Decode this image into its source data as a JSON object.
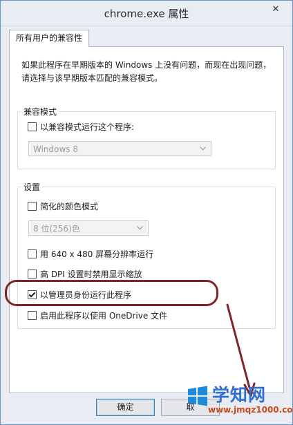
{
  "window": {
    "title": "chrome.exe 属性",
    "close_glyph": "✕"
  },
  "tabs": [
    {
      "label": "所有用户的兼容性",
      "selected": true
    }
  ],
  "description": {
    "line1": "如果此程序在早期版本的 Windows 上没有问题，而现在出现问题，",
    "line2": "请选择与该早期版本匹配的兼容模式。"
  },
  "compat_mode": {
    "legend": "兼容模式",
    "checkbox_label": "以兼容模式运行这个程序:",
    "checked": false,
    "os_select_value": "Windows 8",
    "os_select_enabled": false
  },
  "settings": {
    "legend": "设置",
    "reduced_color": {
      "label": "简化的颜色模式",
      "checked": false
    },
    "color_select_value": "8 位(256)色",
    "color_select_enabled": false,
    "res_640": {
      "label": "用 640 x 480 屏幕分辨率运行",
      "checked": false
    },
    "high_dpi": {
      "label": "高 DPI 设置时禁用显示缩放",
      "checked": false
    },
    "run_as_admin": {
      "label": "以管理员身份运行此程序",
      "checked": true
    },
    "onedrive": {
      "label": "启用此程序以使用 OneDrive 文件",
      "checked": false
    }
  },
  "buttons": {
    "ok": "确定",
    "cancel_partial": "取"
  },
  "annotation": {
    "highlight_color": "#7d2527"
  },
  "watermark": {
    "name": "学知网",
    "url": "www.jmqz1000.com"
  },
  "icons": {
    "close": "close-icon",
    "dropdown": "chevron-down-icon",
    "logo": "windows-logo-icon"
  }
}
